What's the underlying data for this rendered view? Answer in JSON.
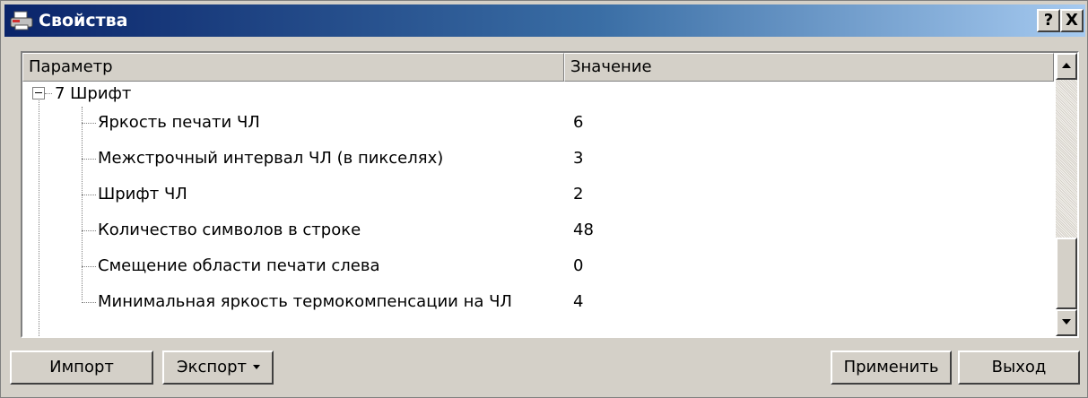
{
  "window": {
    "title": "Свойства",
    "title_icon": "printer-icon",
    "help_label": "?",
    "close_label": "X"
  },
  "grid": {
    "headers": {
      "param": "Параметр",
      "value": "Значение"
    },
    "category": {
      "label": "7 Шрифт",
      "expanded": true
    },
    "rows": [
      {
        "param": "Яркость печати ЧЛ",
        "value": "6"
      },
      {
        "param": "Межстрочный интервал ЧЛ (в пикселях)",
        "value": "3"
      },
      {
        "param": "Шрифт ЧЛ",
        "value": "2"
      },
      {
        "param": "Количество символов в строке",
        "value": "48"
      },
      {
        "param": "Смещение области печати слева",
        "value": "0"
      },
      {
        "param": "Минимальная яркость термокомпенсации на ЧЛ",
        "value": "4"
      }
    ]
  },
  "buttons": {
    "import": "Импорт",
    "export": "Экспорт",
    "apply": "Применить",
    "exit": "Выход"
  },
  "colors": {
    "titlebar_start": "#0a246a",
    "titlebar_end": "#a6caf0",
    "face": "#d4d0c8"
  }
}
